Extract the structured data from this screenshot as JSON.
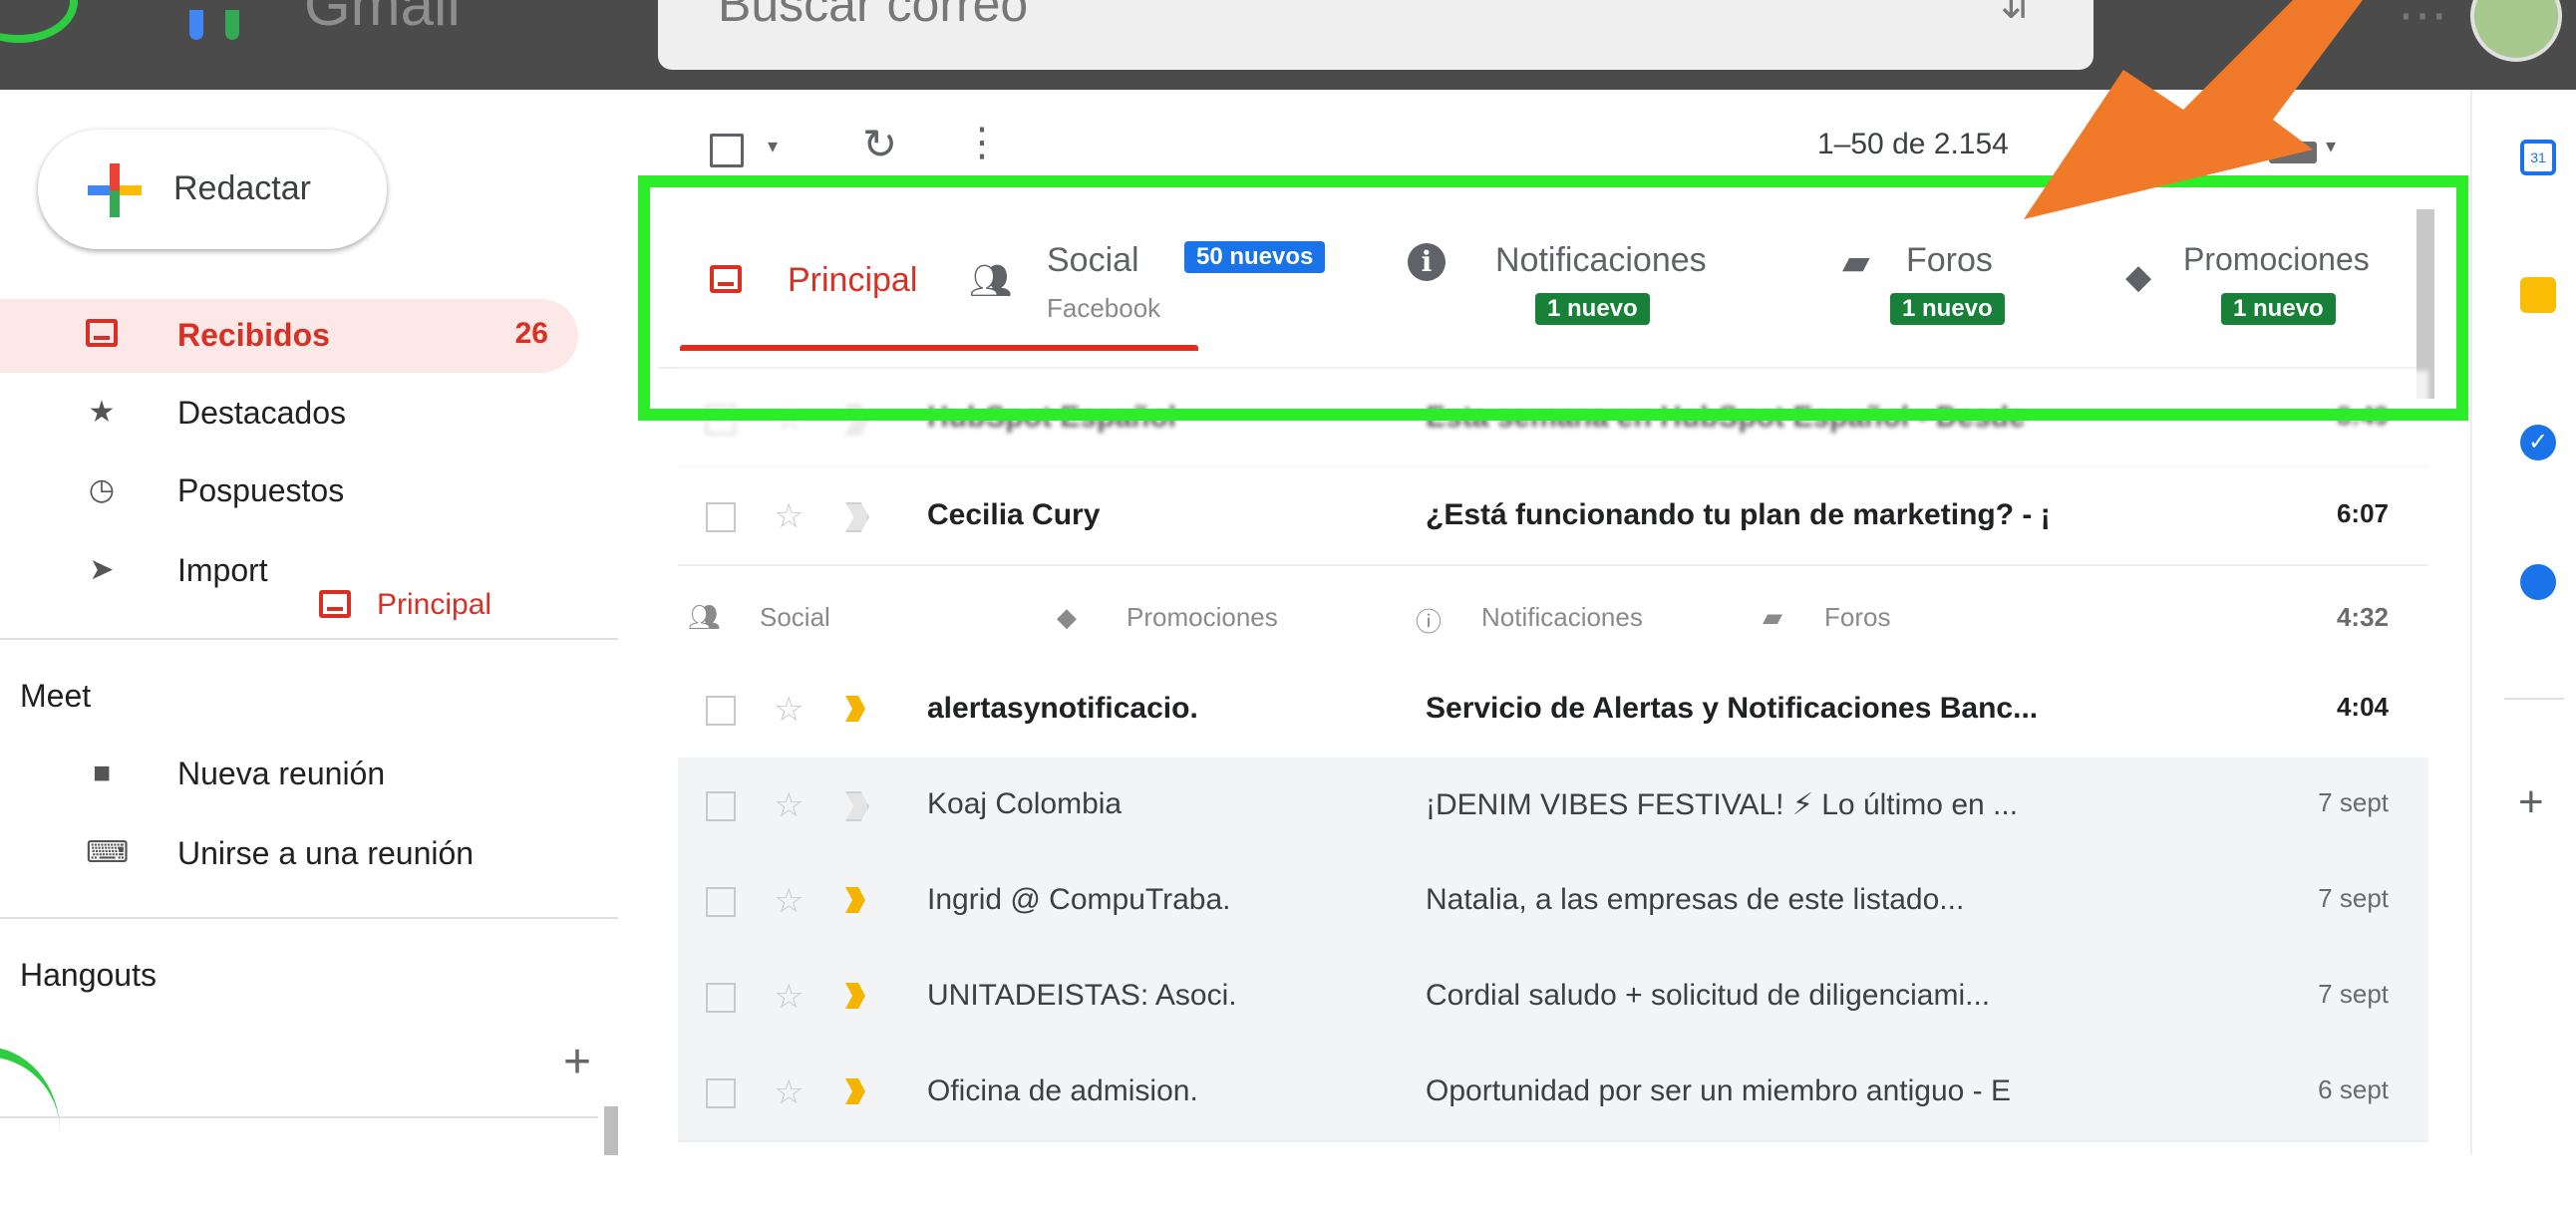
{
  "header": {
    "app_name": "Gmail",
    "search_placeholder": "Buscar correo"
  },
  "compose": {
    "label": "Redactar"
  },
  "nav": {
    "items": [
      {
        "label": "Recibidos",
        "count": "26",
        "icon": "inbox-icon",
        "active": true
      },
      {
        "label": "Destacados",
        "icon": "star-icon"
      },
      {
        "label": "Pospuestos",
        "icon": "clock-icon"
      },
      {
        "label": "Import",
        "icon": "important-icon"
      }
    ],
    "drag_chip_label": "Principal"
  },
  "meet": {
    "title": "Meet",
    "items": [
      {
        "label": "Nueva reunión",
        "icon": "video-icon"
      },
      {
        "label": "Unirse a una reunión",
        "icon": "keyboard-icon"
      }
    ]
  },
  "hangouts": {
    "title": "Hangouts"
  },
  "toolbar": {
    "range": "1–50 de 2.154"
  },
  "tabs": [
    {
      "label": "Principal",
      "icon": "inbox-icon",
      "active": true
    },
    {
      "label": "Social",
      "icon": "people-icon",
      "badge": "50 nuevos",
      "sub": "Facebook",
      "badge_color": "#1a73e8"
    },
    {
      "label": "Notificaciones",
      "icon": "info-icon",
      "badge": "1 nuevo",
      "badge_color": "#188038"
    },
    {
      "label": "Foros",
      "icon": "forum-icon",
      "badge": "1 nuevo",
      "badge_color": "#188038"
    },
    {
      "label": "Promociones",
      "icon": "tag-icon",
      "badge": "1 nuevo",
      "badge_color": "#188038"
    }
  ],
  "category_row": {
    "labels": [
      "Social",
      "Promociones",
      "Notificaciones",
      "Foros"
    ],
    "date": "4:32"
  },
  "emails": [
    {
      "sender": "HubSpot Español",
      "subject": "Esta semana en HubSpot Español - Desde",
      "date": "8:49",
      "unread": true
    },
    {
      "sender": "Cecilia Cury",
      "subject": "¿Está funcionando tu plan de marketing? - ¡",
      "date": "6:07",
      "unread": true
    },
    {
      "sender": "alertasynotificacio.",
      "subject": "Servicio de Alertas y Notificaciones Banc...",
      "date": "4:04",
      "unread": true
    },
    {
      "sender": "Koaj Colombia",
      "subject": "¡DENIM VIBES FESTIVAL! ⚡ Lo último en ...",
      "date": "7 sept",
      "unread": false
    },
    {
      "sender": "Ingrid @ CompuTraba.",
      "subject": "Natalia, a las empresas de este listado...",
      "date": "7 sept",
      "unread": false
    },
    {
      "sender": "UNITADEISTAS: Asoci.",
      "subject": "Cordial saludo + solicitud de diligenciami...",
      "date": "7 sept",
      "unread": false
    },
    {
      "sender": "Oficina de admision.",
      "subject": "Oportunidad por ser un miembro antiguo - E",
      "date": "6 sept",
      "unread": false
    }
  ],
  "colors": {
    "accent_red": "#d93025",
    "highlight_green": "#2ded2b",
    "arrow_orange": "#f07a2a"
  }
}
